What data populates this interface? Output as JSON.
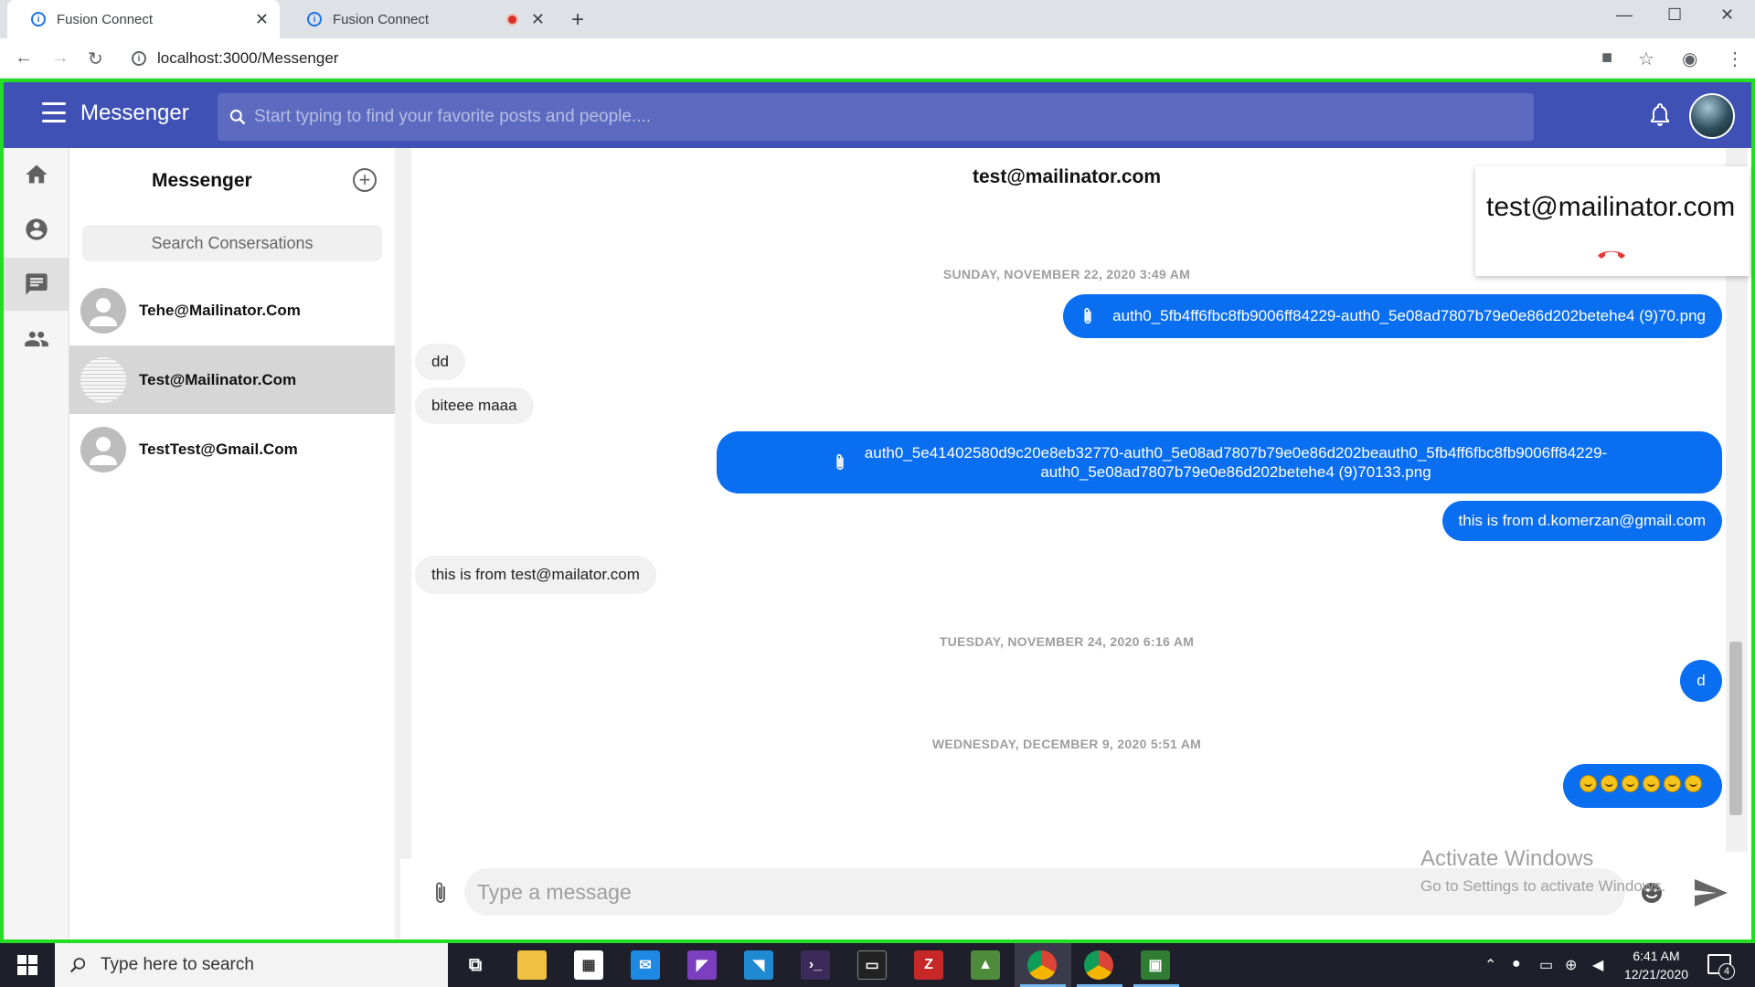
{
  "browser": {
    "tabs": [
      {
        "title": "Fusion Connect",
        "active": true,
        "close": "✕"
      },
      {
        "title": "Fusion Connect",
        "active": false,
        "close": "✕",
        "recording": true
      }
    ],
    "new_tab": "+",
    "url": "localhost:3000/Messenger",
    "window_controls": {
      "minimize": "—",
      "maximize": "☐",
      "close": "✕"
    }
  },
  "app": {
    "title": "Messenger",
    "search_placeholder": "Start typing to find your favorite posts and people....",
    "brand_color": "#3f51b5",
    "rail": [
      "home-icon",
      "account-icon",
      "chat-icon",
      "people-icon"
    ]
  },
  "conversations": {
    "title": "Messenger",
    "search_placeholder": "Search Consersations",
    "items": [
      {
        "name": "Tehe@Mailinator.Com",
        "selected": false
      },
      {
        "name": "Test@Mailinator.Com",
        "selected": true
      },
      {
        "name": "TestTest@Gmail.Com",
        "selected": false
      }
    ]
  },
  "chat": {
    "header": "test@mailinator.com",
    "dates": [
      "SUNDAY, NOVEMBER 22, 2020 3:49 AM",
      "TUESDAY, NOVEMBER 24, 2020 6:16 AM",
      "WEDNESDAY, DECEMBER 9, 2020 5:51 AM"
    ],
    "messages": [
      {
        "from": "me",
        "text": "auth0_5fb4ff6fbc8fb9006ff84229-auth0_5e08ad7807b79e0e86d202betehe4 (9)70.png",
        "attachment": true
      },
      {
        "from": "them",
        "text": "dd"
      },
      {
        "from": "them",
        "text": "biteee maaa"
      },
      {
        "from": "me",
        "line1": "auth0_5e41402580d9c20e8eb32770-auth0_5e08ad7807b79e0e86d202beauth0_5fb4ff6fbc8fb9006ff84229-",
        "line2": "auth0_5e08ad7807b79e0e86d202betehe4 (9)70133.png",
        "attachment": true
      },
      {
        "from": "me",
        "text": "this is from d.komerzan@gmail.com"
      },
      {
        "from": "them",
        "text": "this is from test@mailator.com"
      },
      {
        "from": "me",
        "text": "d"
      },
      {
        "from": "me",
        "text": "😁😁😁😁😁😁",
        "emoji_count": 6
      }
    ],
    "composer_placeholder": "Type a message",
    "my_bubble_color": "#0a6ef0"
  },
  "call": {
    "name": "test@mailinator.com",
    "hangup_icon": "call-end-icon"
  },
  "watermark": {
    "line1": "Activate Windows",
    "line2": "Go to Settings to activate Windows."
  },
  "taskbar": {
    "search_text": "Type here to search",
    "time": "6:41 AM",
    "date": "12/21/2020",
    "notification_count": "4"
  }
}
